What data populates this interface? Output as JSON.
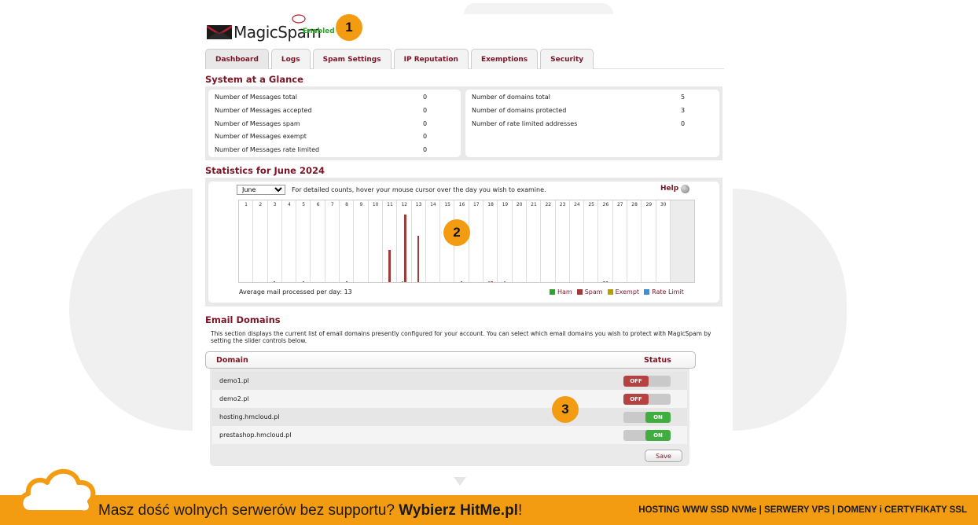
{
  "brand": {
    "name": "MagicSpam",
    "status": "Enabled"
  },
  "markers": [
    "1",
    "2",
    "3"
  ],
  "tabs": [
    "Dashboard",
    "Logs",
    "Spam Settings",
    "IP Reputation",
    "Exemptions",
    "Security"
  ],
  "glance": {
    "title": "System at a Glance",
    "left": [
      {
        "label": "Number of Messages total",
        "value": "0"
      },
      {
        "label": "Number of Messages accepted",
        "value": "0"
      },
      {
        "label": "Number of Messages spam",
        "value": "0"
      },
      {
        "label": "Number of Messages exempt",
        "value": "0"
      },
      {
        "label": "Number of Messages rate limited",
        "value": "0"
      }
    ],
    "right": [
      {
        "label": "Number of domains total",
        "value": "5"
      },
      {
        "label": "Number of domains protected",
        "value": "3"
      },
      {
        "label": "Number of rate limited addresses",
        "value": "0"
      }
    ]
  },
  "stats": {
    "title": "Statistics for June 2024",
    "month_selected": "June",
    "hint": "For detailed counts, hover your mouse cursor over the day you wish to examine.",
    "help": "Help",
    "average": "Average mail processed per day: 13",
    "legend": [
      "Ham",
      "Spam",
      "Exempt",
      "Rate Limit"
    ]
  },
  "chart_data": {
    "type": "bar",
    "title": "Statistics for June 2024",
    "categories": [
      "1",
      "2",
      "3",
      "4",
      "5",
      "6",
      "7",
      "8",
      "9",
      "10",
      "11",
      "12",
      "13",
      "14",
      "15",
      "16",
      "17",
      "18",
      "19",
      "20",
      "21",
      "22",
      "23",
      "24",
      "25",
      "26",
      "27",
      "28",
      "29",
      "30"
    ],
    "series": [
      {
        "name": "Ham",
        "color": "#2da52d",
        "values": [
          0,
          0,
          0,
          0,
          0,
          0,
          0,
          0,
          0,
          0,
          0,
          1,
          0,
          0,
          0,
          0,
          0,
          1,
          1,
          0,
          0,
          0,
          0,
          0,
          0,
          1,
          0,
          0,
          0,
          0
        ]
      },
      {
        "name": "Spam",
        "color": "#a33a3a",
        "values": [
          0,
          0,
          1,
          0,
          1,
          0,
          0,
          1,
          0,
          0,
          40,
          84,
          58,
          0,
          0,
          1,
          0,
          1,
          0,
          0,
          0,
          0,
          0,
          0,
          0,
          1,
          0,
          0,
          0,
          0
        ]
      },
      {
        "name": "Exempt",
        "color": "#b8a000",
        "values": [
          0,
          0,
          0,
          0,
          0,
          0,
          0,
          0,
          0,
          0,
          0,
          0,
          0,
          0,
          0,
          0,
          0,
          0,
          0,
          0,
          0,
          0,
          0,
          0,
          0,
          0,
          0,
          0,
          0,
          0
        ]
      },
      {
        "name": "Rate Limit",
        "color": "#3d8fd6",
        "values": [
          0,
          0,
          0,
          0,
          0,
          0,
          0,
          0,
          0,
          0,
          0,
          0,
          0,
          0,
          0,
          0,
          0,
          0,
          0,
          0,
          0,
          0,
          0,
          0,
          0,
          0,
          0,
          0,
          0,
          0
        ]
      }
    ],
    "ylim": [
      0,
      90
    ],
    "grid": false,
    "legend": "bottom-right"
  },
  "domains": {
    "title": "Email Domains",
    "description": "This section displays the current list of email domains presently configured for your account. You can select which email domains you wish to protect with MagicSpam by setting the slider controls below.",
    "col_domain": "Domain",
    "col_status": "Status",
    "rows": [
      {
        "name": "demo1.pl",
        "status": "OFF"
      },
      {
        "name": "demo2.pl",
        "status": "OFF"
      },
      {
        "name": "hosting.hmcloud.pl",
        "status": "ON"
      },
      {
        "name": "prestashop.hmcloud.pl",
        "status": "ON"
      }
    ],
    "save": "Save"
  },
  "footer": {
    "lead": "Masz dość wolnych serwerów bez supportu? ",
    "brand": "Wybierz HitMe.pl",
    "trail": "!",
    "right": "HOSTING WWW SSD NVMe | SERWERY VPS | DOMENY i CERTYFIKATY SSL"
  },
  "colors": {
    "accent": "#7a1526",
    "orange": "#f39c12",
    "ham": "#2da52d",
    "spam": "#a33a3a",
    "exempt": "#b8a000",
    "ratelimit": "#3d8fd6"
  }
}
